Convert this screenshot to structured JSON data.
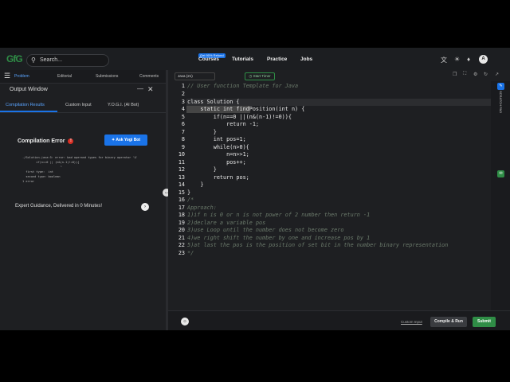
{
  "nav": {
    "logo": "GfG",
    "search_placeholder": "Search...",
    "badge": "Get 90% Refund",
    "links": [
      "Courses",
      "Tutorials",
      "Practice",
      "Jobs"
    ],
    "avatar": "A"
  },
  "left_tabs": [
    "Problem",
    "Editorial",
    "Submissions",
    "Comments"
  ],
  "output": {
    "title": "Output Window",
    "tabs": [
      "Compilation Results",
      "Custom Input",
      "Y.O.G.I. (AI Bot)"
    ],
    "error_title": "Compilation Error",
    "ask_button": "Ask Yogi Bot",
    "error_text": "./Solution.java:5: error: bad operand types for binary operator '&'\n        if(n==0 || (n&(n-1)!=0)){\n                      ^\n  first type:  int\n  second type: boolean\n1 error",
    "guidance": "Expert Guidance, Delivered in 0 Minutes!"
  },
  "editor": {
    "language": "Java (21)",
    "timer": "Start Timer",
    "lines": [
      "// User function Template for Java",
      "",
      "class Solution {",
      "    static int findPosition(int n) {",
      "        if(n==0 ||(n&(n-1)!=0)){",
      "            return -1;",
      "        }",
      "        int pos=1;",
      "        while(n>0){",
      "            n=n>>1;",
      "            pos++;",
      "        }",
      "        return pos;",
      "    }",
      "}",
      "/*",
      "Approach:",
      "1)if n is 0 or n is not power of 2 number then return -1",
      "2)declare a variable pos",
      "3)use Loop until the number does not become zero",
      "4)we right shift the number by one and increase pos by 1",
      "5)at last the pos is the position of set bit in the number binary representation",
      "*/"
    ],
    "line_numbers": [
      "1",
      "2",
      "3",
      "4",
      "5",
      "6",
      "7",
      "8",
      "9",
      "10",
      "11",
      "12",
      "13",
      "14",
      "15",
      "16",
      "17",
      "18",
      "19",
      "20",
      "21",
      "22",
      "23"
    ],
    "side_label": "SCRATCH PAD",
    "custom_input": "Custom Input",
    "compile_run": "Compile & Run",
    "submit": "Submit"
  }
}
